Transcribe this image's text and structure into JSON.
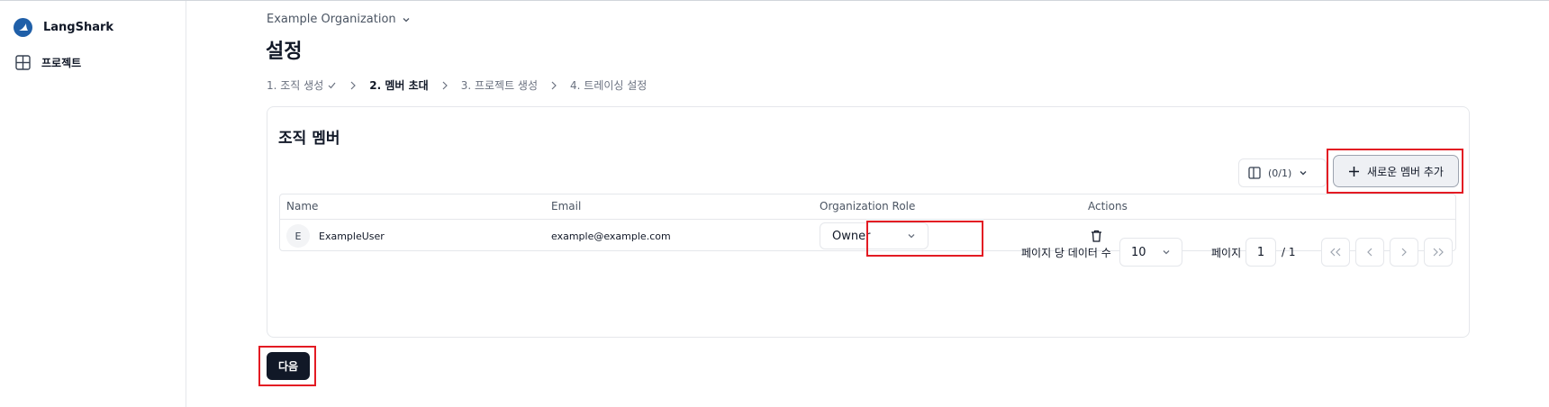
{
  "sidebar": {
    "brand": "LangShark",
    "items": [
      {
        "label": "프로젝트",
        "icon": "grid-icon"
      }
    ]
  },
  "header": {
    "org_name": "Example Organization",
    "title": "설정"
  },
  "steps": [
    {
      "label": "1. 조직 생성",
      "done": true
    },
    {
      "label": "2. 멤버 초대",
      "active": true
    },
    {
      "label": "3. 프로젝트 생성"
    },
    {
      "label": "4. 트레이싱 설정"
    }
  ],
  "members": {
    "title": "조직 멤버",
    "column_toggle": "(0/1)",
    "add_button": "새로운 멤버 추가",
    "columns": [
      "Name",
      "Email",
      "Organization Role",
      "Actions"
    ],
    "rows": [
      {
        "initial": "E",
        "name": "ExampleUser",
        "email": "example@example.com",
        "role": "Owner"
      }
    ],
    "pagination": {
      "rows_label": "페이지 당 데이터 수",
      "rows_per_page": "10",
      "page_label": "페이지",
      "page": "1",
      "total": "/ 1"
    }
  },
  "footer": {
    "next_label": "다음"
  },
  "colors": {
    "primary": "#111827",
    "highlight": "#e31b23",
    "brand": "#1f5fa8"
  }
}
